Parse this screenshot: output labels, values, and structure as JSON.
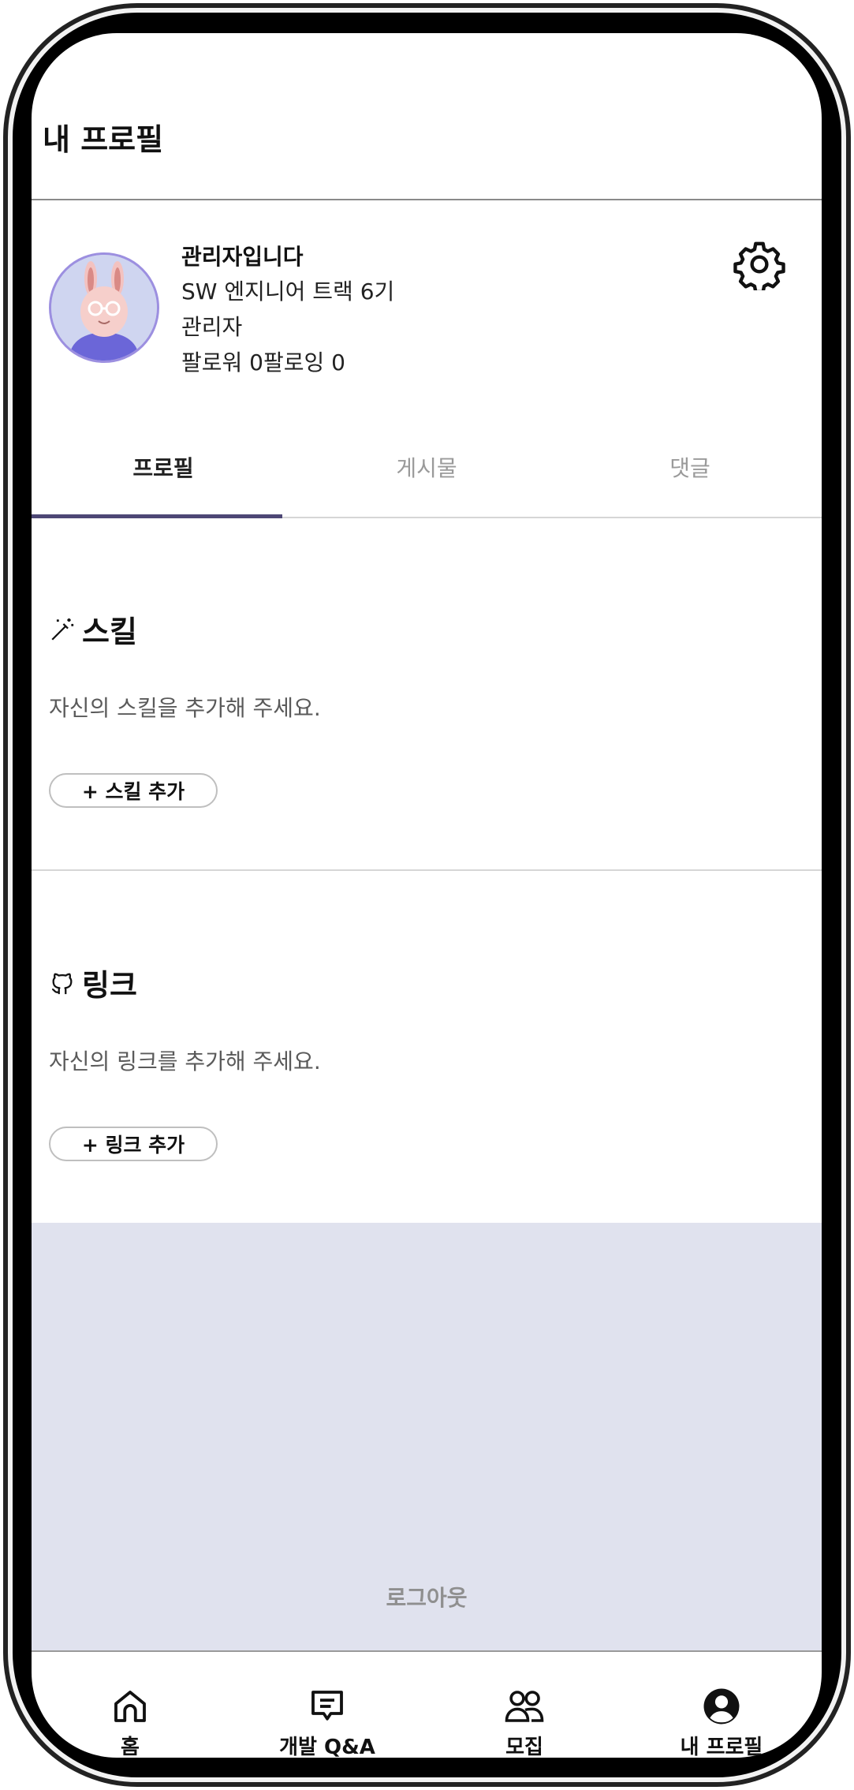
{
  "header": {
    "title": "내 프로필"
  },
  "profile": {
    "name": "관리자입니다",
    "track": "SW 엔지니어 트랙 6기",
    "role": "관리자",
    "follow": "팔로워 0팔로잉 0"
  },
  "tabs": [
    {
      "label": "프로필",
      "active": true
    },
    {
      "label": "게시물",
      "active": false
    },
    {
      "label": "댓글",
      "active": false
    }
  ],
  "skills": {
    "icon": "magic-wand-icon",
    "title": "스킬",
    "description": "자신의 스킬을 추가해 주세요.",
    "button": "+ 스킬 추가"
  },
  "links": {
    "icon": "github-icon",
    "title": "링크",
    "description": "자신의 링크를 추가해 주세요.",
    "button": "+ 링크 추가"
  },
  "logout": "로그아웃",
  "bottom_nav": [
    {
      "icon": "home-icon",
      "label": "홈"
    },
    {
      "icon": "chat-icon",
      "label": "개발 Q&A"
    },
    {
      "icon": "people-icon",
      "label": "모집"
    },
    {
      "icon": "user-icon",
      "label": "내 프로필",
      "active": true
    }
  ],
  "colors": {
    "accent": "#4d4775",
    "footer_bg": "#e0e2ee",
    "avatar_border": "#9c8fe0"
  }
}
